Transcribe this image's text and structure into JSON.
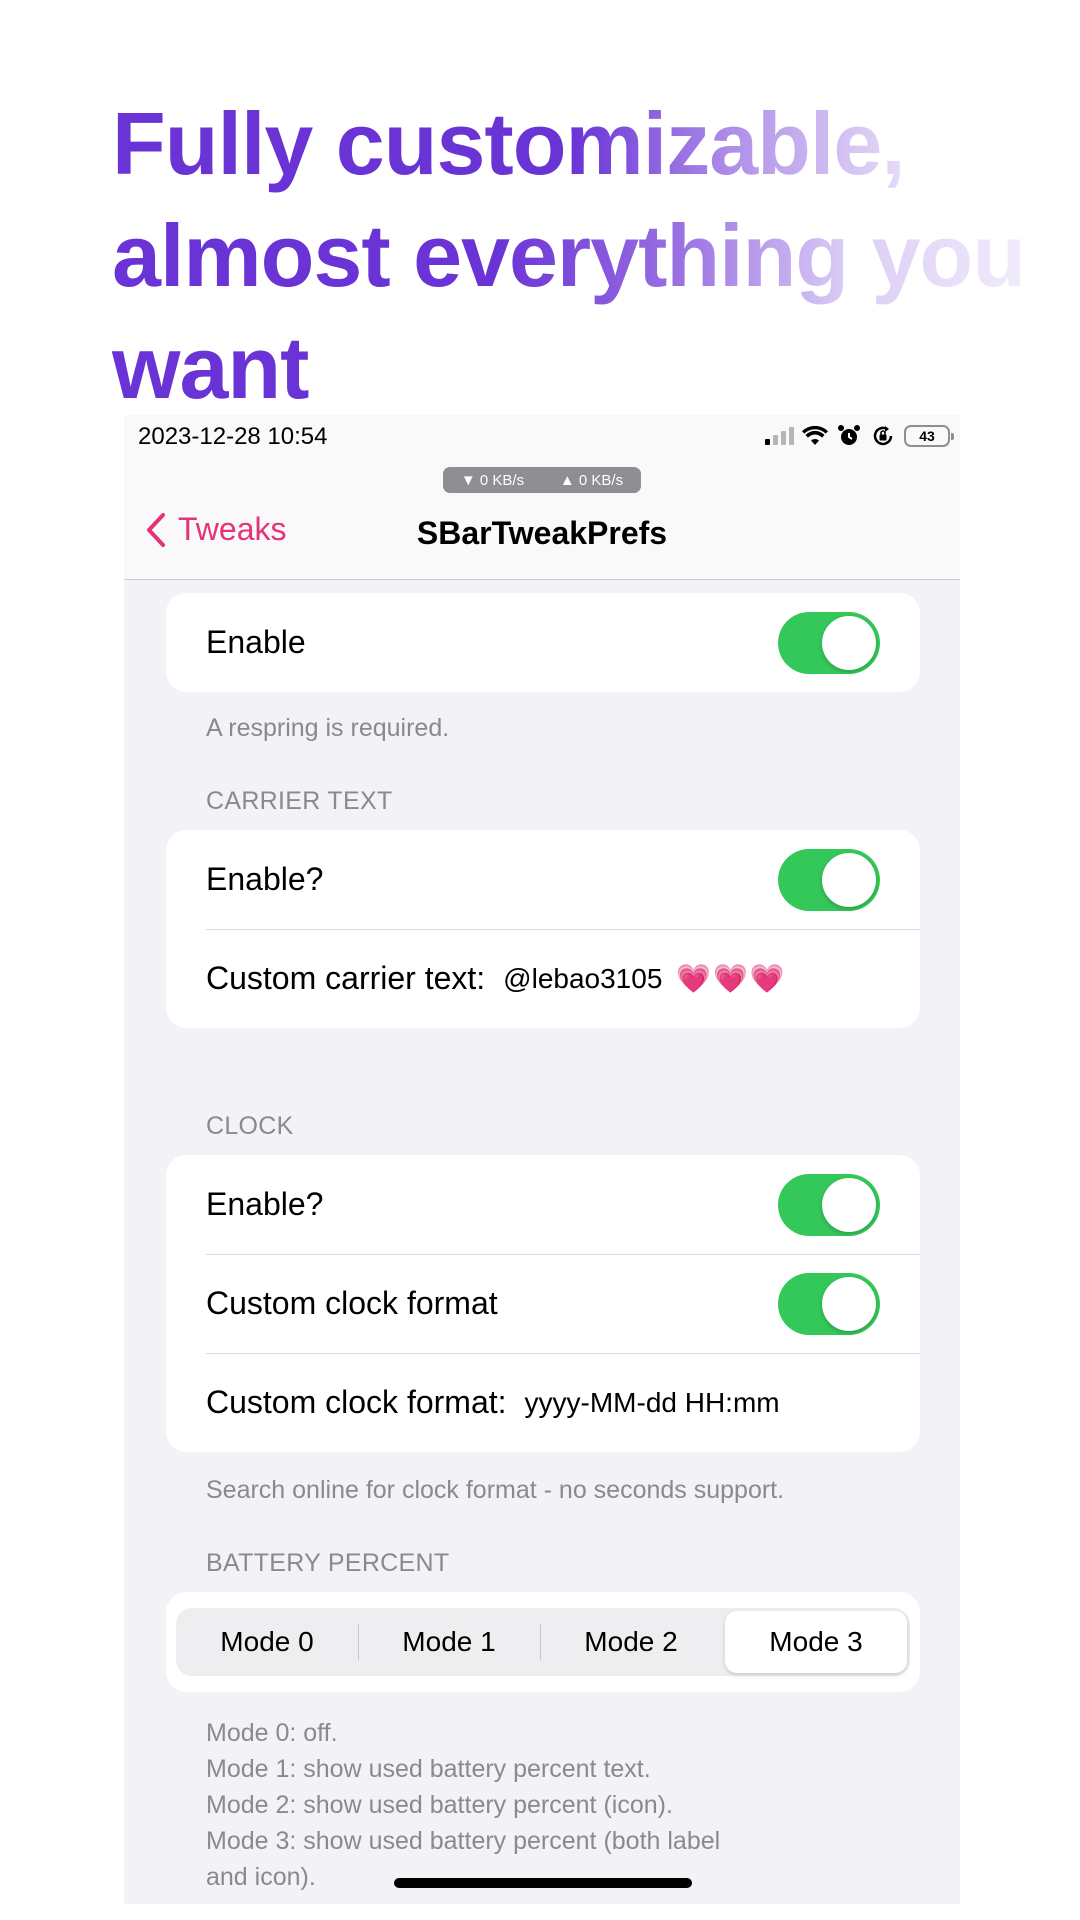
{
  "headline": {
    "line1": "Fully customizable,",
    "line2": "almost everything you",
    "line3": "want"
  },
  "status_bar": {
    "time": "2023-12-28 10:54",
    "battery": "43"
  },
  "net_speed": {
    "down": "▼ 0 KB/s",
    "up": "▲ 0 KB/s"
  },
  "nav": {
    "back_label": "Tweaks",
    "title": "SBarTweakPrefs",
    "accent_color": "#e5327a"
  },
  "sections": {
    "main": {
      "enable_label": "Enable",
      "enable_on": true,
      "footer": "A respring is required."
    },
    "carrier": {
      "header": "CARRIER TEXT",
      "enable_label": "Enable?",
      "enable_on": true,
      "custom_label": "Custom carrier text:",
      "custom_value": "@lebao3105",
      "custom_emoji": "💗💗💗"
    },
    "clock": {
      "header": "CLOCK",
      "enable_label": "Enable?",
      "enable_on": true,
      "custom_format_toggle_label": "Custom clock format",
      "custom_format_on": true,
      "format_label": "Custom clock format:",
      "format_value": "yyyy-MM-dd HH:mm",
      "footer": "Search online for clock format - no seconds support."
    },
    "battery": {
      "header": "BATTERY PERCENT",
      "modes": [
        "Mode 0",
        "Mode 1",
        "Mode 2",
        "Mode 3"
      ],
      "selected_mode": "Mode 3",
      "footer_lines": [
        "Mode 0: off.",
        "Mode 1: show used battery percent text.",
        "Mode 2: show used battery percent (icon).",
        "Mode 3: show used battery percent (both label",
        "and icon)."
      ]
    }
  },
  "colors": {
    "toggle_on": "#34c759",
    "headline_purple": "#6a33d6"
  }
}
